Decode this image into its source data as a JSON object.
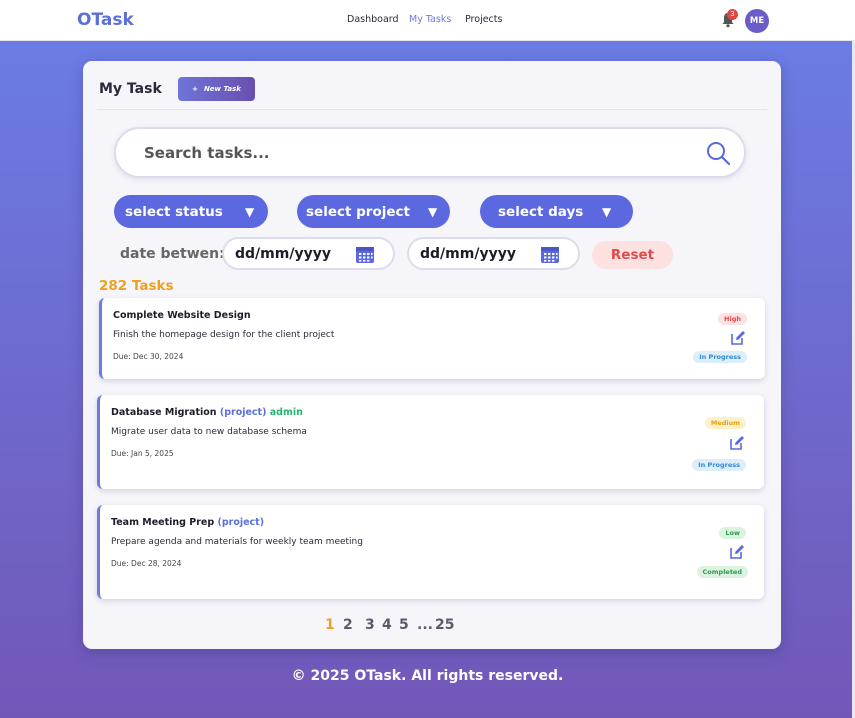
{
  "nav": {
    "brand": "OTask",
    "links": [
      "Dashboard",
      "My Tasks",
      "Projects"
    ],
    "active": "My Tasks",
    "notifications": "3",
    "avatar_initials": "ME"
  },
  "panel": {
    "title": "My Task",
    "new_task_label": "New Task",
    "new_task_icon": "+"
  },
  "search": {
    "placeholder": "Search tasks..."
  },
  "filters": {
    "status": "select status",
    "project": "select project",
    "days": "select days",
    "caret": "▼"
  },
  "dates": {
    "label": "date betwen:",
    "from_placeholder": "dd/mm/yyyy",
    "to_placeholder": "dd/mm/yyyy",
    "reset_label": "Reset"
  },
  "task_count": "282 Tasks",
  "tasks": [
    {
      "title": "Complete Website Design",
      "project_tag": "",
      "owner_tag": "",
      "description": "Finish the homepage design for the client project",
      "due": "Due: Dec 30, 2024",
      "priority": "High",
      "status": "In Progress"
    },
    {
      "title": "Database Migration",
      "project_tag": "(project)",
      "owner_tag": "admin",
      "description": "Migrate user data to new database schema",
      "due": "Due: Jan 5, 2025",
      "priority": "Medium",
      "status": "In Progress"
    },
    {
      "title": "Team Meeting Prep",
      "project_tag": "(project)",
      "owner_tag": "",
      "description": "Prepare agenda and materials for weekly team meeting",
      "due": "Due: Dec 28, 2024",
      "priority": "Low",
      "status": "Completed"
    }
  ],
  "pagination": {
    "pages": [
      "1",
      "2",
      "3",
      "4",
      "5",
      "...",
      "25"
    ],
    "current": "1"
  },
  "footer": "© 2025 OTask. All rights reserved.",
  "colors": {
    "accent": "#5b68e0",
    "brand": "#5b6fd8",
    "count": "#f0a020",
    "reset": "#e14a4a"
  }
}
